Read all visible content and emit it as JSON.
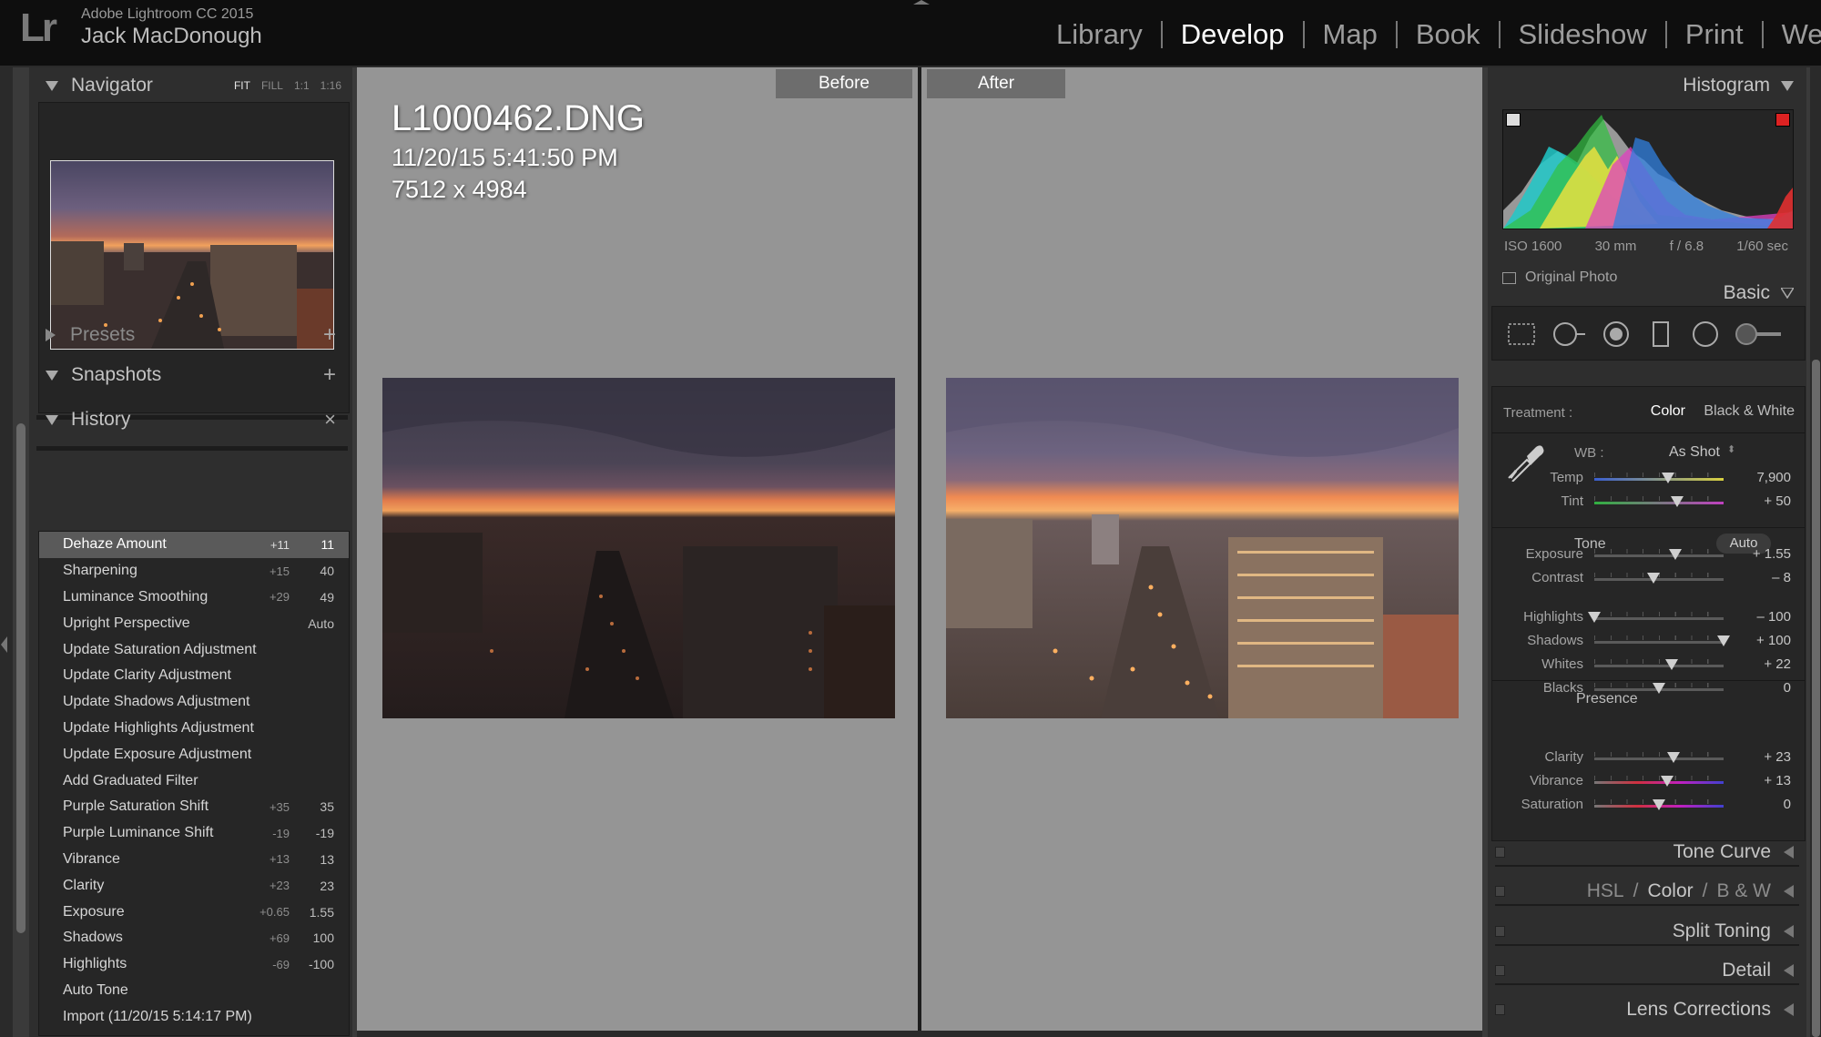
{
  "app": {
    "name": "Adobe Lightroom CC 2015",
    "user": "Jack MacDonough",
    "logo": "Lr"
  },
  "modules": [
    "Library",
    "Develop",
    "Map",
    "Book",
    "Slideshow",
    "Print",
    "Web"
  ],
  "active_module": "Develop",
  "navigator": {
    "title": "Navigator",
    "options": [
      "FIT",
      "FILL",
      "1:1",
      "1:16"
    ],
    "active_option": "FIT"
  },
  "presets": {
    "title": "Presets"
  },
  "snapshots": {
    "title": "Snapshots"
  },
  "history": {
    "title": "History",
    "items": [
      {
        "name": "Dehaze Amount",
        "delta": "+11",
        "value": "11",
        "selected": true
      },
      {
        "name": "Sharpening",
        "delta": "+15",
        "value": "40"
      },
      {
        "name": "Luminance Smoothing",
        "delta": "+29",
        "value": "49"
      },
      {
        "name": "Upright Perspective",
        "delta": "",
        "value": "Auto"
      },
      {
        "name": "Update Saturation Adjustment",
        "delta": "",
        "value": ""
      },
      {
        "name": "Update Clarity Adjustment",
        "delta": "",
        "value": ""
      },
      {
        "name": "Update Shadows Adjustment",
        "delta": "",
        "value": ""
      },
      {
        "name": "Update Highlights Adjustment",
        "delta": "",
        "value": ""
      },
      {
        "name": "Update Exposure Adjustment",
        "delta": "",
        "value": ""
      },
      {
        "name": "Add Graduated Filter",
        "delta": "",
        "value": ""
      },
      {
        "name": "Purple Saturation Shift",
        "delta": "+35",
        "value": "35"
      },
      {
        "name": "Purple Luminance Shift",
        "delta": "-19",
        "value": "-19"
      },
      {
        "name": "Vibrance",
        "delta": "+13",
        "value": "13"
      },
      {
        "name": "Clarity",
        "delta": "+23",
        "value": "23"
      },
      {
        "name": "Exposure",
        "delta": "+0.65",
        "value": "1.55"
      },
      {
        "name": "Shadows",
        "delta": "+69",
        "value": "100"
      },
      {
        "name": "Highlights",
        "delta": "-69",
        "value": "-100"
      },
      {
        "name": "Auto Tone",
        "delta": "",
        "value": ""
      },
      {
        "name": "Import (11/20/15 5:14:17 PM)",
        "delta": "",
        "value": ""
      }
    ]
  },
  "view": {
    "before_label": "Before",
    "after_label": "After",
    "filename": "L1000462.DNG",
    "datetime": "11/20/15 5:41:50 PM",
    "dimensions": "7512 x 4984"
  },
  "histogram": {
    "title": "Histogram",
    "iso": "ISO 1600",
    "focal": "30 mm",
    "aperture": "f / 6.8",
    "shutter": "1/60 sec",
    "original_photo": "Original Photo"
  },
  "basic": {
    "title": "Basic",
    "treatment_label": "Treatment :",
    "treatment_color": "Color",
    "treatment_bw": "Black & White",
    "wb_label": "WB :",
    "wb_value": "As Shot",
    "tone_label": "Tone",
    "auto_label": "Auto",
    "presence_label": "Presence",
    "sliders": [
      {
        "name": "Temp",
        "value": "7,900",
        "level": 0.57
      },
      {
        "name": "Tint",
        "value": "+ 50",
        "level": 0.64
      },
      {
        "name": "Exposure",
        "value": "+ 1.55",
        "level": 0.63
      },
      {
        "name": "Contrast",
        "value": "– 8",
        "level": 0.46
      },
      {
        "name": "Highlights",
        "value": "– 100",
        "level": 0.0
      },
      {
        "name": "Shadows",
        "value": "+ 100",
        "level": 1.0
      },
      {
        "name": "Whites",
        "value": "+ 22",
        "level": 0.6
      },
      {
        "name": "Blacks",
        "value": "0",
        "level": 0.5
      },
      {
        "name": "Clarity",
        "value": "+ 23",
        "level": 0.61
      },
      {
        "name": "Vibrance",
        "value": "+ 13",
        "level": 0.56
      },
      {
        "name": "Saturation",
        "value": "0",
        "level": 0.5
      }
    ]
  },
  "collapsed_panels": [
    {
      "title": "Tone Curve"
    },
    {
      "hsl": "HSL",
      "sep": "/",
      "color": "Color",
      "bw": "B & W"
    },
    {
      "title": "Split Toning"
    },
    {
      "title": "Detail"
    },
    {
      "title": "Lens Corrections"
    }
  ]
}
